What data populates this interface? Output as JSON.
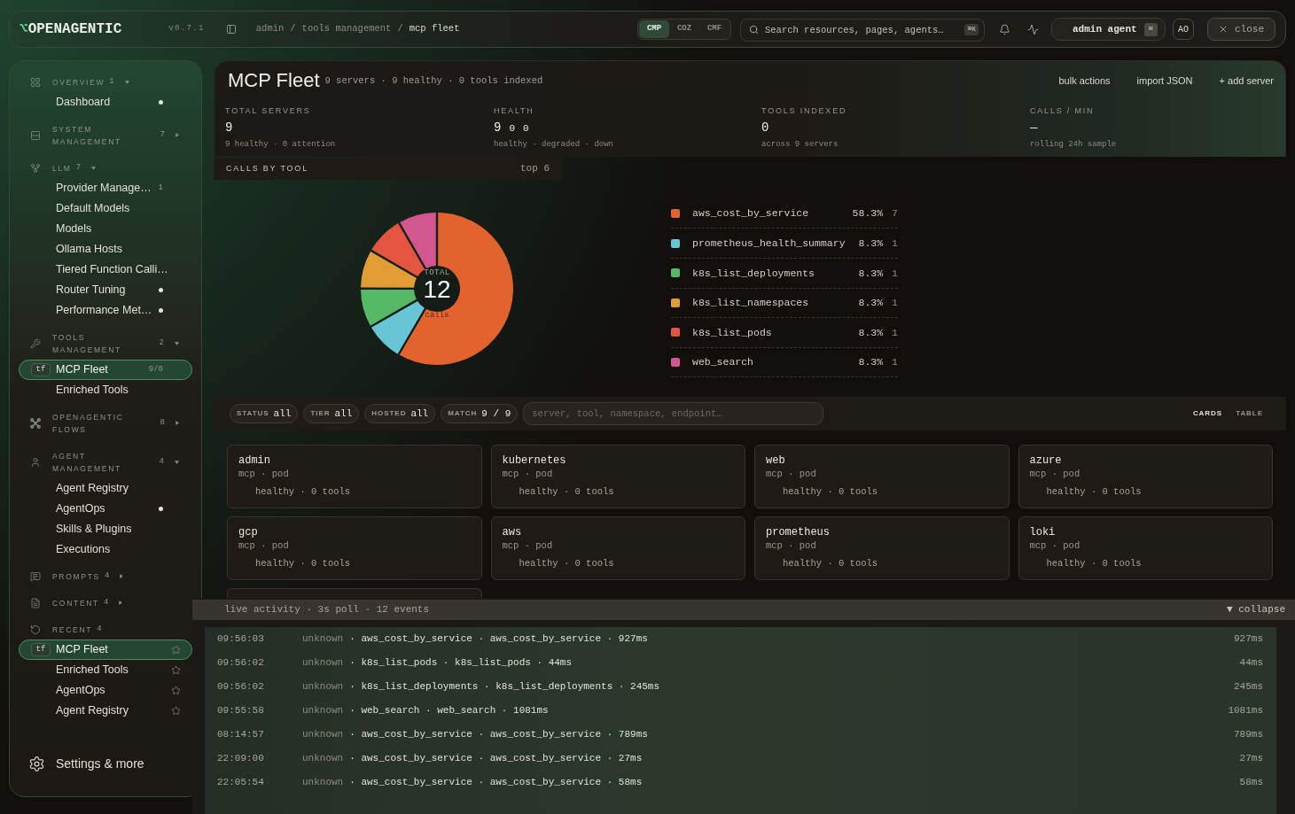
{
  "topbar": {
    "logo_mark": "⌥",
    "logo": "OPENAGENTIC",
    "version": "v0.7.1",
    "breadcrumb_separator": "/",
    "breadcrumb": [
      {
        "label": "admin",
        "current": false
      },
      {
        "label": "tools management",
        "current": false
      },
      {
        "label": "mcp fleet",
        "current": true
      }
    ],
    "density": [
      {
        "label": "CMP",
        "selected": true
      },
      {
        "label": "COZ",
        "selected": false
      },
      {
        "label": "CMF",
        "selected": false
      }
    ],
    "search": {
      "placeholder": "Search resources, pages, agents…",
      "shortcut": "⌘K"
    },
    "user": {
      "name": "admin agent",
      "shortcut": "⌘"
    },
    "initials": "AO",
    "close": "close"
  },
  "sidebar": {
    "sections": [
      {
        "label": "OVERVIEW",
        "count": "1",
        "expanded": true,
        "items": [
          {
            "label": "Dashboard",
            "dot": true,
            "selected": false
          }
        ]
      },
      {
        "label": "SYSTEM MANAGEMENT",
        "count": "7",
        "expanded": false
      },
      {
        "label": "LLM",
        "count": "7",
        "expanded": true,
        "items": [
          {
            "label": "Provider Manage…",
            "count": "1",
            "dot": false,
            "selected": false
          },
          {
            "label": "Default Models",
            "dot": false,
            "selected": false
          },
          {
            "label": "Models",
            "dot": false,
            "selected": false
          },
          {
            "label": "Ollama Hosts",
            "dot": false,
            "selected": false
          },
          {
            "label": "Tiered Function Calli…",
            "dot": false,
            "selected": false
          },
          {
            "label": "Router Tuning",
            "dot": true,
            "selected": false
          },
          {
            "label": "Performance Met…",
            "dot": true,
            "selected": false
          }
        ]
      },
      {
        "label": "TOOLS MANAGEMENT",
        "count": "2",
        "expanded": true,
        "items": [
          {
            "label": "MCP Fleet",
            "badge": "tf",
            "count": "9/0",
            "dot": false,
            "selected": true
          },
          {
            "label": "Enriched Tools",
            "dot": false,
            "selected": false
          }
        ]
      },
      {
        "label": "OPENAGENTIC FLOWS",
        "count": "8",
        "expanded": false
      },
      {
        "label": "AGENT MANAGEMENT",
        "count": "4",
        "expanded": true,
        "items": [
          {
            "label": "Agent Registry",
            "dot": false,
            "selected": false
          },
          {
            "label": "AgentOps",
            "dot": true,
            "selected": false
          },
          {
            "label": "Skills & Plugins",
            "dot": false,
            "selected": false
          },
          {
            "label": "Executions",
            "dot": false,
            "selected": false
          }
        ]
      },
      {
        "label": "PROMPTS",
        "count": "4",
        "expanded": false
      },
      {
        "label": "CONTENT",
        "count": "4",
        "expanded": false
      },
      {
        "label": "RECENT",
        "count": "4",
        "items": [
          {
            "label": "MCP Fleet",
            "badge": "tf",
            "dot": false,
            "selected": true,
            "starred": false
          },
          {
            "label": "Enriched Tools",
            "dot": false,
            "selected": false,
            "starred": false
          },
          {
            "label": "AgentOps",
            "dot": false,
            "selected": false,
            "starred": false
          },
          {
            "label": "Agent Registry",
            "dot": false,
            "selected": false,
            "starred": false
          }
        ]
      }
    ],
    "settings": "Settings & more"
  },
  "header": {
    "title": "MCP Fleet",
    "summary": "9 servers · 9 healthy · 0 tools indexed",
    "actions": [
      "bulk actions",
      "import JSON",
      "+ add server"
    ]
  },
  "stats": [
    {
      "label": "TOTAL SERVERS",
      "values": [
        "9"
      ],
      "note": "9 healthy · 0 attention"
    },
    {
      "label": "HEALTH",
      "values": [
        "9",
        "0",
        "0"
      ],
      "note": "healthy · degraded · down"
    },
    {
      "label": "TOOLS INDEXED",
      "values": [
        "0"
      ],
      "note": "across 9 servers"
    },
    {
      "label": "CALLS / MIN",
      "values": [
        "—"
      ],
      "note": "rolling 24h sample"
    }
  ],
  "calls_by_tool": {
    "title": "CALLS BY TOOL",
    "scope": "top 6",
    "center": {
      "label": "TOTAL",
      "value": "12",
      "unit": "calls"
    },
    "chart_data": {
      "type": "donut",
      "legend": "right",
      "categories": [
        "aws_cost_by_service",
        "prometheus_health_summary",
        "k8s_list_deployments",
        "k8s_list_namespaces",
        "k8s_list_pods",
        "web_search"
      ],
      "values": [
        58.3,
        8.3,
        8.3,
        8.3,
        8.3,
        8.3
      ]
    },
    "legend": [
      {
        "color": "#e3632f",
        "percent": "58.3%",
        "count": "7"
      },
      {
        "color": "#67c5d6",
        "percent": "8.3%",
        "count": "1"
      },
      {
        "color": "#55b865",
        "percent": "8.3%",
        "count": "1"
      },
      {
        "color": "#e19d34",
        "percent": "8.3%",
        "count": "1"
      },
      {
        "color": "#e3553e",
        "percent": "8.3%",
        "count": "1"
      },
      {
        "color": "#d2568f",
        "percent": "8.3%",
        "count": "1"
      }
    ]
  },
  "filters": {
    "chips": [
      {
        "label": "STATUS",
        "value": "all"
      },
      {
        "label": "TIER",
        "value": "all"
      },
      {
        "label": "HOSTED",
        "value": "all"
      },
      {
        "label": "MATCH",
        "value": "9 / 9"
      }
    ],
    "search": {
      "placeholder": "server, tool, namespace, endpoint…"
    },
    "views": [
      {
        "label": "CARDS",
        "selected": true
      },
      {
        "label": "TABLE",
        "selected": false
      }
    ]
  },
  "servers": [
    {
      "name": "admin",
      "meta": "mcp · pod",
      "status": "healthy · 0 tools"
    },
    {
      "name": "kubernetes",
      "meta": "mcp · pod",
      "status": "healthy · 0 tools"
    },
    {
      "name": "web",
      "meta": "mcp · pod",
      "status": "healthy · 0 tools"
    },
    {
      "name": "azure",
      "meta": "mcp · pod",
      "status": "healthy · 0 tools"
    },
    {
      "name": "gcp",
      "meta": "mcp · pod",
      "status": "healthy · 0 tools"
    },
    {
      "name": "aws",
      "meta": "mcp · pod",
      "status": "healthy · 0 tools"
    },
    {
      "name": "prometheus",
      "meta": "mcp · pod",
      "status": "healthy · 0 tools"
    },
    {
      "name": "loki",
      "meta": "mcp · pod",
      "status": "healthy · 0 tools"
    }
  ],
  "activity": {
    "summary": "live activity · 3s poll · 12 events",
    "collapse": "▼ collapse",
    "events": [
      {
        "time": "09:56:03",
        "source": "unknown",
        "detail": "· aws_cost_by_service · aws_cost_by_service · 927ms",
        "duration": "927ms"
      },
      {
        "time": "09:56:02",
        "source": "unknown",
        "detail": "· k8s_list_pods · k8s_list_pods · 44ms",
        "duration": "44ms"
      },
      {
        "time": "09:56:02",
        "source": "unknown",
        "detail": "· k8s_list_deployments · k8s_list_deployments · 245ms",
        "duration": "245ms"
      },
      {
        "time": "09:55:58",
        "source": "unknown",
        "detail": "· web_search · web_search · 1081ms",
        "duration": "1081ms"
      },
      {
        "time": "08:14:57",
        "source": "unknown",
        "detail": "· aws_cost_by_service · aws_cost_by_service · 789ms",
        "duration": "789ms"
      },
      {
        "time": "22:09:00",
        "source": "unknown",
        "detail": "· aws_cost_by_service · aws_cost_by_service · 27ms",
        "duration": "27ms"
      },
      {
        "time": "22:05:54",
        "source": "unknown",
        "detail": "· aws_cost_by_service · aws_cost_by_service · 58ms",
        "duration": "58ms"
      }
    ]
  }
}
